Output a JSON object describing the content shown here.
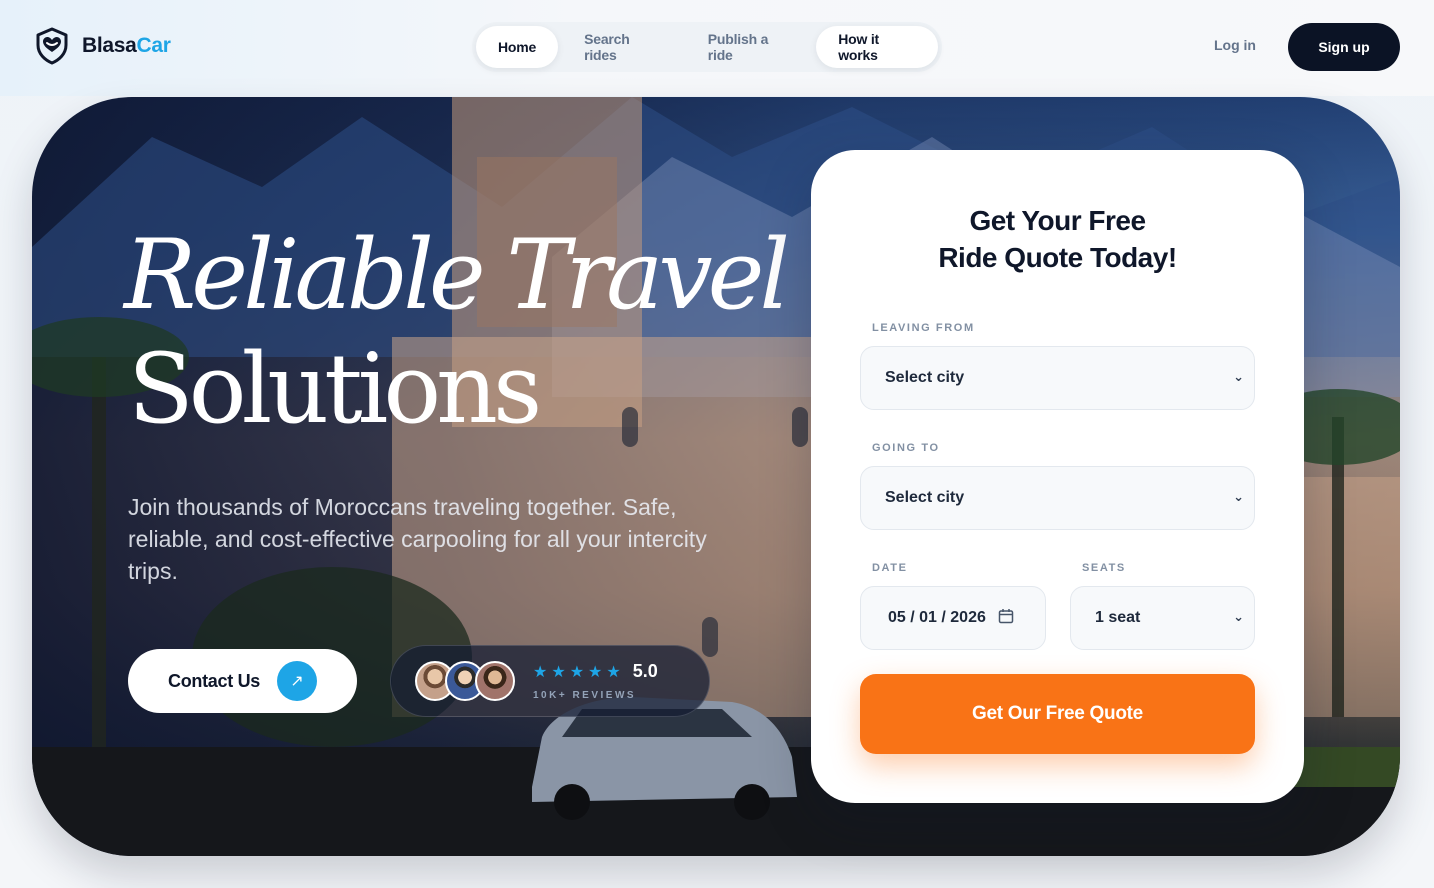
{
  "brand": {
    "name_main": "Blasa",
    "name_accent": "Car",
    "logo_icon": "smiling-heart-shield-icon",
    "accent_color": "#1ea5e6"
  },
  "nav": {
    "items": [
      {
        "label": "Home",
        "state": "active"
      },
      {
        "label": "Search rides",
        "state": "normal"
      },
      {
        "label": "Publish a ride",
        "state": "normal"
      },
      {
        "label": "How it works",
        "state": "highlighted"
      }
    ]
  },
  "auth": {
    "login_label": "Log in",
    "signup_label": "Sign up"
  },
  "hero": {
    "headline_line1": "Reliable Travel",
    "headline_line2": "Solutions",
    "subtitle": "Join thousands of Moroccans traveling together. Safe, reliable, and cost-effective carpooling for all your intercity trips.",
    "contact_label": "Contact Us",
    "contact_icon": "arrow-up-right-icon",
    "reviews": {
      "stars": "★★★★★",
      "rating": "5.0",
      "count_label": "10K+ REVIEWS"
    }
  },
  "quote_form": {
    "title_line1": "Get Your Free",
    "title_line2": "Ride Quote Today!",
    "leaving_from_label": "LEAVING FROM",
    "leaving_from_value": "Select city",
    "going_to_label": "GOING TO",
    "going_to_value": "Select city",
    "date_label": "DATE",
    "date_value": "05 / 01 / 2026",
    "seats_label": "SEATS",
    "seats_value": "1 seat",
    "submit_label": "Get Our Free Quote",
    "submit_color": "#f97316"
  }
}
